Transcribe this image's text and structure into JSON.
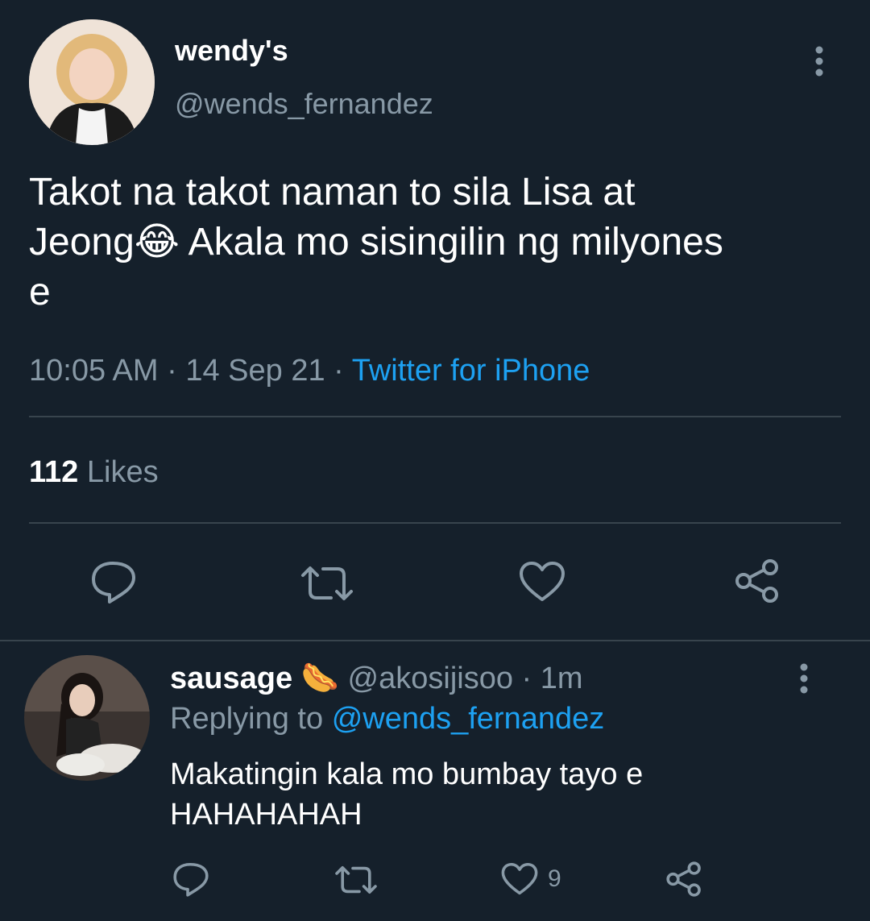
{
  "tweet": {
    "display_name": "wendy's",
    "handle": "@wends_fernandez",
    "text_line1": "Takot na takot naman to sila Lisa at",
    "text_line2_a": "Jeong",
    "text_emoji": "😂",
    "text_line2_b": " Akala mo sisingilin ng milyones",
    "text_line3": "e",
    "time": "10:05 AM",
    "sep": "·",
    "date": "14 Sep 21",
    "source": "Twitter for iPhone",
    "likes_count": "112",
    "likes_label": "Likes"
  },
  "reply": {
    "display_name": "sausage",
    "name_emoji": "🌭",
    "handle": "@akosijisoo",
    "sep": "·",
    "age": "1m",
    "replying_label": "Replying to",
    "replying_to": "@wends_fernandez",
    "text_line1": "Makatingin kala mo bumbay tayo e",
    "text_line2": "HAHAHAHAH",
    "like_count": "9"
  },
  "icons": {
    "menu": "more-vertical-icon",
    "reply": "reply-icon",
    "retweet": "retweet-icon",
    "like": "heart-icon",
    "share": "share-icon"
  },
  "colors": {
    "background": "#15202b",
    "muted": "#8899a6",
    "link": "#1da1f2",
    "divider": "#38444d"
  }
}
